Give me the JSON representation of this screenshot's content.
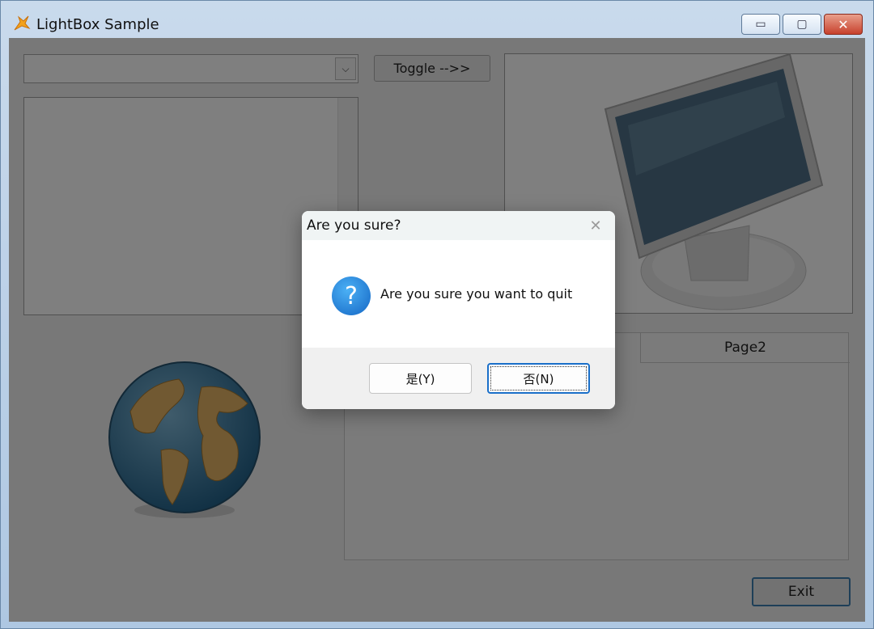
{
  "window": {
    "title": "LightBox Sample",
    "controls": {
      "minimize": "▭",
      "maximize": "▢",
      "close": "✕"
    }
  },
  "form": {
    "combo_value": "",
    "toggle_label": "Toggle -->>",
    "tab_page2": "Page2",
    "exit_label": "Exit"
  },
  "dialog": {
    "title": "Are you sure?",
    "close_glyph": "✕",
    "icon": "question-icon",
    "icon_glyph": "?",
    "message": "Are you sure you want to quit",
    "yes_label": "是(Y)",
    "no_label": "否(N)"
  },
  "colors": {
    "overlay": "#000000",
    "dialog_bg": "#ffffff",
    "dialog_footer": "#f0f0f0",
    "accent": "#1a6fc9",
    "close_button": "#c7412d"
  }
}
